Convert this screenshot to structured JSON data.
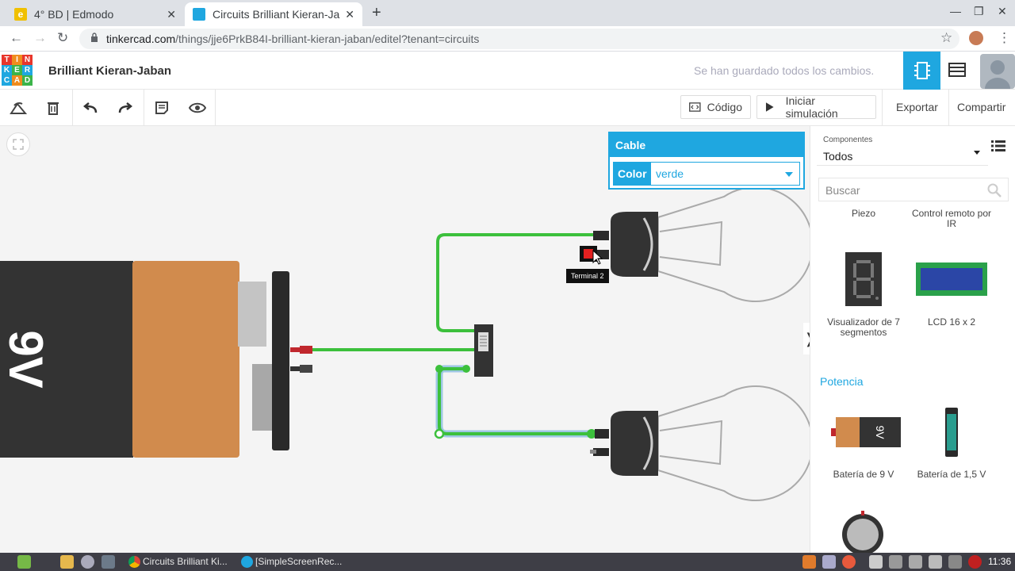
{
  "browser": {
    "tabs": [
      {
        "title": "4° BD | Edmodo",
        "active": false
      },
      {
        "title": "Circuits Brilliant Kieran-Ja",
        "active": true
      }
    ],
    "url_domain": "tinkercad.com",
    "url_path": "/things/jje6PrkB84I-brilliant-kieran-jaban/editel?tenant=circuits"
  },
  "header": {
    "logo_letters": [
      "T",
      "I",
      "N",
      "K",
      "E",
      "R",
      "C",
      "A",
      "D"
    ],
    "project_title": "Brilliant Kieran-Jaban",
    "saved_message": "Se han guardado todos los cambios."
  },
  "toolbar": {
    "code_label": "Código",
    "simulate_label": "Iniciar simulación",
    "export_label": "Exportar",
    "share_label": "Compartir"
  },
  "inspector": {
    "title": "Cable",
    "color_label": "Color",
    "color_value": "verde"
  },
  "canvas": {
    "battery_label": "9V",
    "tooltip": "Terminal 2"
  },
  "components_panel": {
    "category_small": "Componentes",
    "category": "Todos",
    "search_placeholder": "Buscar",
    "items_top": [
      {
        "label": "Piezo"
      },
      {
        "label": "Control remoto por IR"
      }
    ],
    "items": [
      {
        "label": "Visualizador de 7 segmentos"
      },
      {
        "label": "LCD 16 x 2"
      }
    ],
    "section_power": "Potencia",
    "power_items": [
      {
        "label": "Batería de 9 V"
      },
      {
        "label": "Batería de 1,5 V"
      }
    ]
  },
  "taskbar": {
    "items": [
      {
        "label": "Circuits Brilliant Ki..."
      },
      {
        "label": "[SimpleScreenRec..."
      }
    ],
    "clock": "11:36"
  },
  "colors": {
    "accent": "#1fa7e0",
    "wire_green": "#3cc03c",
    "battery_orange": "#d18b4d",
    "battery_dark": "#333333"
  }
}
